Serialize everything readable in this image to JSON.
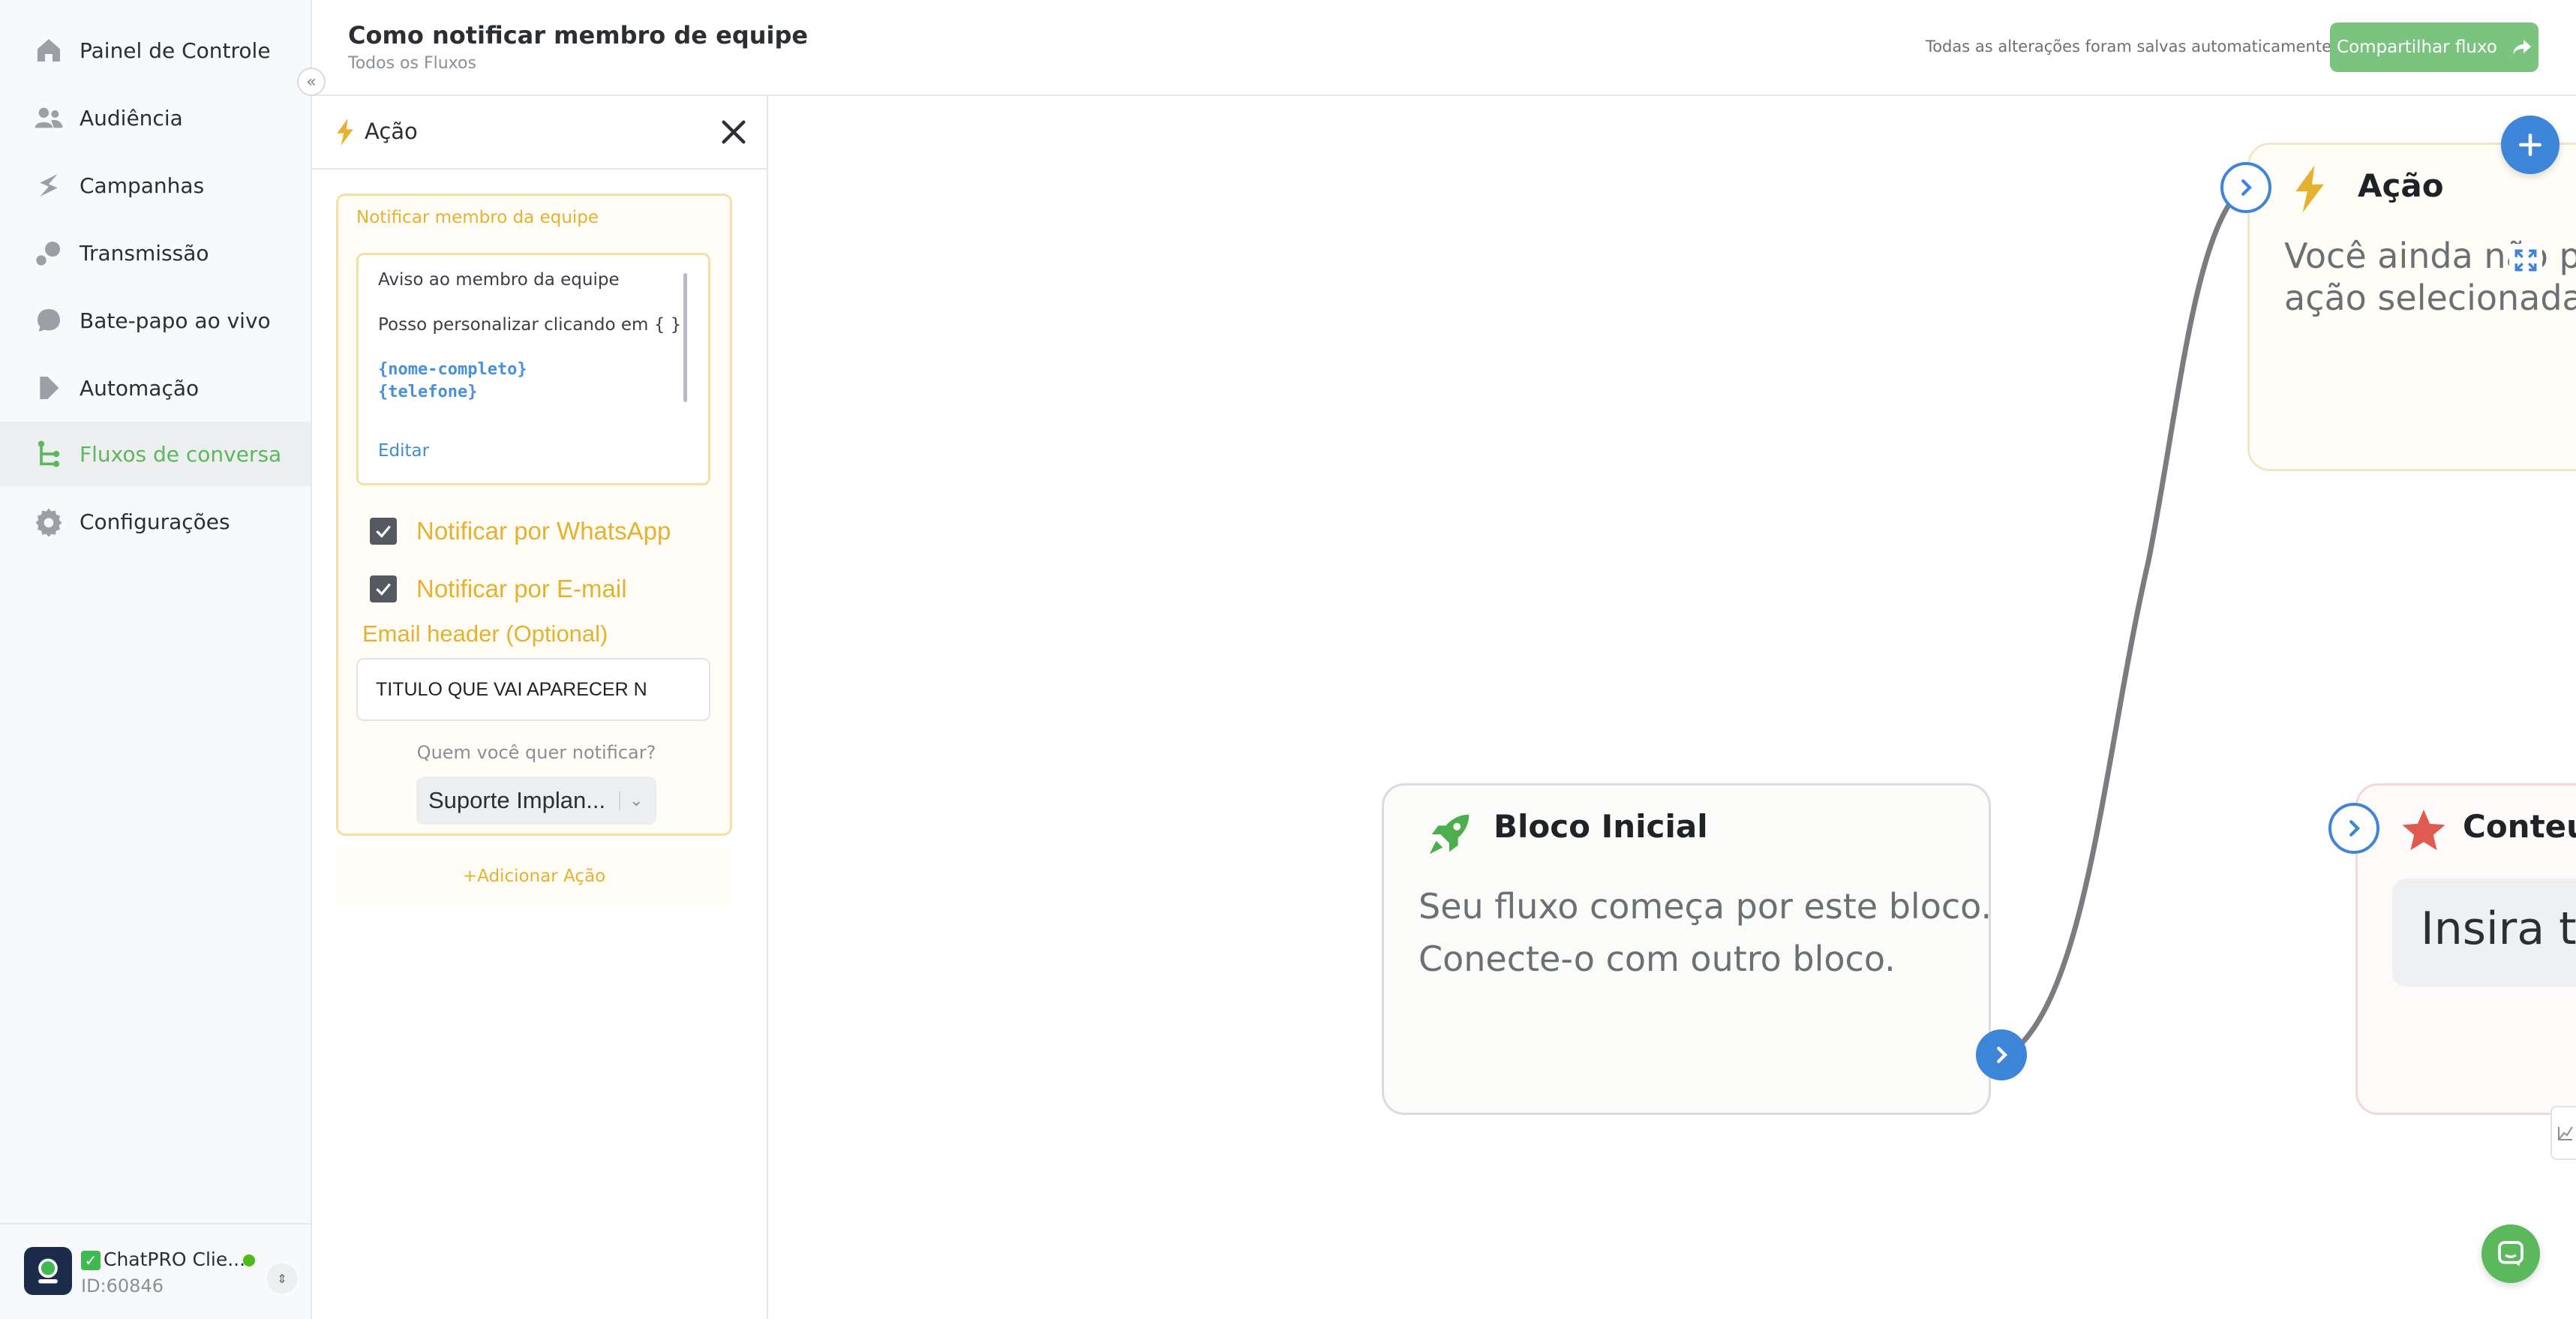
{
  "sidebar": {
    "items": [
      {
        "label": "Painel de Controle",
        "icon": "home-icon"
      },
      {
        "label": "Audiência",
        "icon": "users-icon"
      },
      {
        "label": "Campanhas",
        "icon": "campaigns-icon"
      },
      {
        "label": "Transmissão",
        "icon": "broadcast-icon"
      },
      {
        "label": "Bate-papo ao vivo",
        "icon": "chat-bubble-icon"
      },
      {
        "label": "Automação",
        "icon": "automation-icon"
      },
      {
        "label": "Fluxos de conversa",
        "icon": "flow-icon",
        "active": true
      },
      {
        "label": "Configurações",
        "icon": "gear-icon"
      }
    ],
    "account": {
      "name": "ChatPRO Clie...",
      "id": "ID:60846",
      "status": "online"
    }
  },
  "header": {
    "title": "Como notificar membro de equipe",
    "breadcrumb": "Todos os Fluxos",
    "save_status": "Todas as alterações foram salvas automaticamente",
    "share_label": "Compartilhar fluxo"
  },
  "panel": {
    "title": "Ação",
    "notify_card": {
      "heading": "Notificar membro da equipe",
      "message_lines": [
        "Aviso ao membro da equipe",
        "Posso personalizar clicando em { }"
      ],
      "variables": [
        "{nome-completo}",
        "{telefone}"
      ],
      "edit_label": "Editar"
    },
    "checkboxes": {
      "whatsapp": {
        "label": "Notificar por WhatsApp",
        "checked": true
      },
      "email": {
        "label": "Notificar por E-mail",
        "checked": true
      }
    },
    "email_header": {
      "label": "Email header (Optional)",
      "value": "TITULO QUE VAI APARECER N"
    },
    "who_label": "Quem você quer notificar?",
    "member_select_value": "Suporte Implan...",
    "add_action_label": "+Adicionar Ação"
  },
  "canvas": {
    "start_node": {
      "title": "Bloco Inicial",
      "text_lines": [
        "Seu fluxo começa por este bloco.",
        "Conecte-o com outro bloco."
      ]
    },
    "action_node": {
      "title": "Ação",
      "text_lines": [
        "Você ainda não po",
        "ação selecionada"
      ]
    },
    "content_node": {
      "title": "Conteú",
      "input_text": "Insira te"
    }
  },
  "colors": {
    "accent_green": "#5cb85c",
    "accent_blue": "#3d85d8",
    "action_yellow": "#e6b12f",
    "content_red": "#e05a4f"
  }
}
